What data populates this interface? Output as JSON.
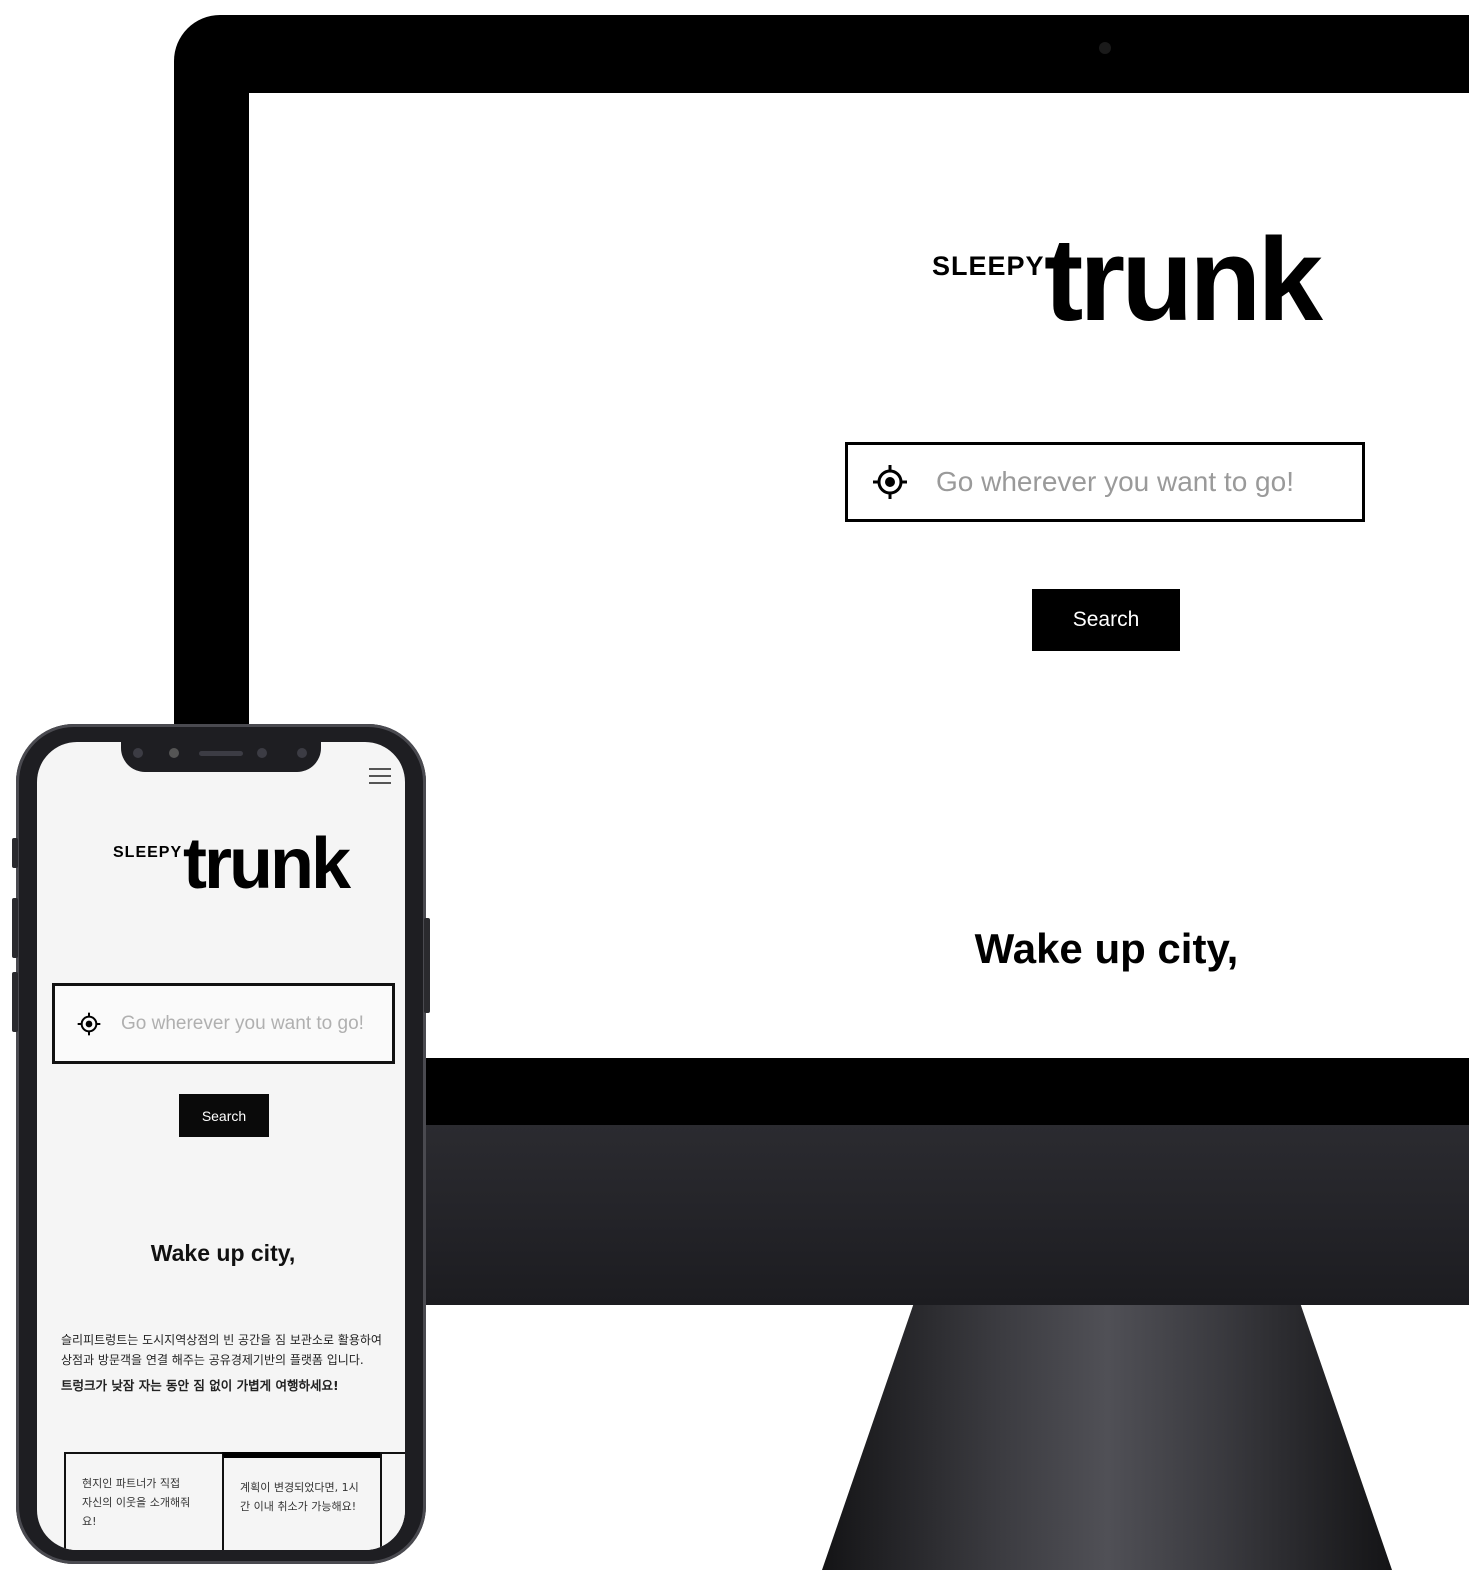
{
  "desktop": {
    "logo": {
      "small": "SLEEPY",
      "big": "trunk"
    },
    "search": {
      "icon": "location-target-icon",
      "placeholder": "Go wherever you want to go!"
    },
    "search_button": "Search",
    "headline": "Wake up city,"
  },
  "mobile": {
    "menu_icon": "hamburger-menu-icon",
    "logo": {
      "small": "SLEEPY",
      "big": "trunk"
    },
    "search": {
      "icon": "location-target-icon",
      "placeholder": "Go wherever you want to go!"
    },
    "search_button": "Search",
    "headline": "Wake up city,",
    "description": "슬리피트렁트는 도시지역상점의 빈 공간을 짐 보관소로 활용하여 상점과 방문객을 연결 해주는 공유경제기반의 플랫폼 입니다.",
    "tagline": "트렁크가 낮잠 자는 동안 짐 없이 가볍게 여행하세요!",
    "cards": [
      {
        "text": "현지인 파트너가 직접 자신의 이웃을 소개해줘요!"
      },
      {
        "text": "계획이 변경되었다면, 1시간 이내 취소가 가능해요!"
      }
    ]
  }
}
